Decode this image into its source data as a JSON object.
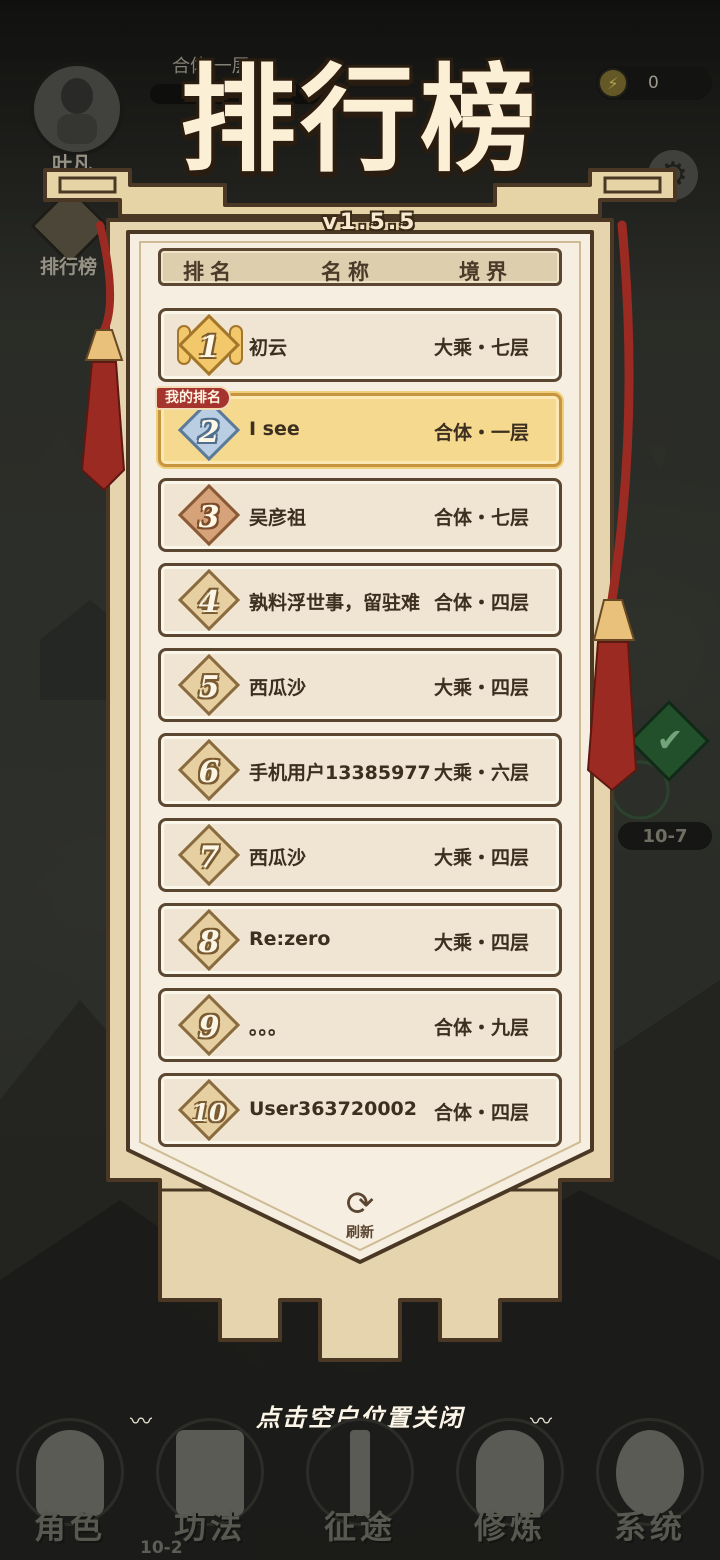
{
  "hud": {
    "player_name": "叶凡",
    "player_realm": "合体·一层",
    "coin_value": "0",
    "rank_button_label": "排行榜",
    "stage_label": "10-7",
    "stage_label_bottom": "10-2"
  },
  "leaderboard": {
    "title": "排行榜",
    "version": "v1.5.5",
    "headers": {
      "rank": "排名",
      "name": "名称",
      "realm": "境界"
    },
    "my_rank_tag": "我的排名",
    "rows": [
      {
        "rank": "1",
        "name": "初云",
        "realm": "大乘・七层"
      },
      {
        "rank": "2",
        "name": "I see",
        "realm": "合体・一层"
      },
      {
        "rank": "3",
        "name": "吴彦祖",
        "realm": "合体・七层"
      },
      {
        "rank": "4",
        "name": "孰料浮世事，留驻难",
        "realm": "合体・四层"
      },
      {
        "rank": "5",
        "name": "西瓜沙",
        "realm": "大乘・四层"
      },
      {
        "rank": "6",
        "name": "手机用户13385977",
        "realm": "大乘・六层"
      },
      {
        "rank": "7",
        "name": "西瓜沙",
        "realm": "大乘・四层"
      },
      {
        "rank": "8",
        "name": "Re:zero",
        "realm": "大乘・四层"
      },
      {
        "rank": "9",
        "name": "。。。",
        "realm": "合体・九层"
      },
      {
        "rank": "10",
        "name": "User363720002",
        "realm": "合体・四层"
      }
    ],
    "refresh_label": "刷新"
  },
  "close_hint": "点击空白位置关闭",
  "nav": [
    {
      "label": "角色",
      "icon": "character-icon"
    },
    {
      "label": "功法",
      "icon": "scroll-book-icon"
    },
    {
      "label": "征途",
      "icon": "sword-icon"
    },
    {
      "label": "修炼",
      "icon": "meditation-icon"
    },
    {
      "label": "系统",
      "icon": "system-girl-icon"
    }
  ],
  "colors": {
    "banner_fill": "#f6efe1",
    "banner_border": "#5b4631",
    "highlight_row": "#f4d98e",
    "tassel_red": "#9a2a22",
    "my_rank_tag": "#a5342e"
  }
}
